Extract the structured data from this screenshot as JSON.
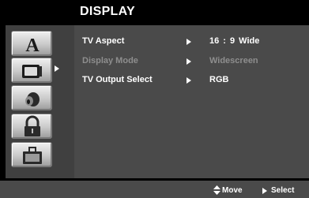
{
  "title": "DISPLAY",
  "sidebar": {
    "icons": [
      {
        "name": "language-icon",
        "selected": false
      },
      {
        "name": "display-tv-icon",
        "selected": true
      },
      {
        "name": "audio-icon",
        "selected": false
      },
      {
        "name": "lock-icon",
        "selected": false
      },
      {
        "name": "others-icon",
        "selected": false
      }
    ]
  },
  "menu": {
    "rows": [
      {
        "label": "TV Aspect",
        "value": "16 : 9 Wide",
        "enabled": true
      },
      {
        "label": "Display Mode",
        "value": "Widescreen",
        "enabled": false
      },
      {
        "label": "TV Output Select",
        "value": "RGB",
        "enabled": true
      }
    ]
  },
  "footer": {
    "move_label": "Move",
    "select_label": "Select"
  },
  "colors": {
    "text": "#ffffff",
    "disabled_text": "#8e8e8e",
    "panel": "#4a4a4a",
    "background": "#000000"
  }
}
